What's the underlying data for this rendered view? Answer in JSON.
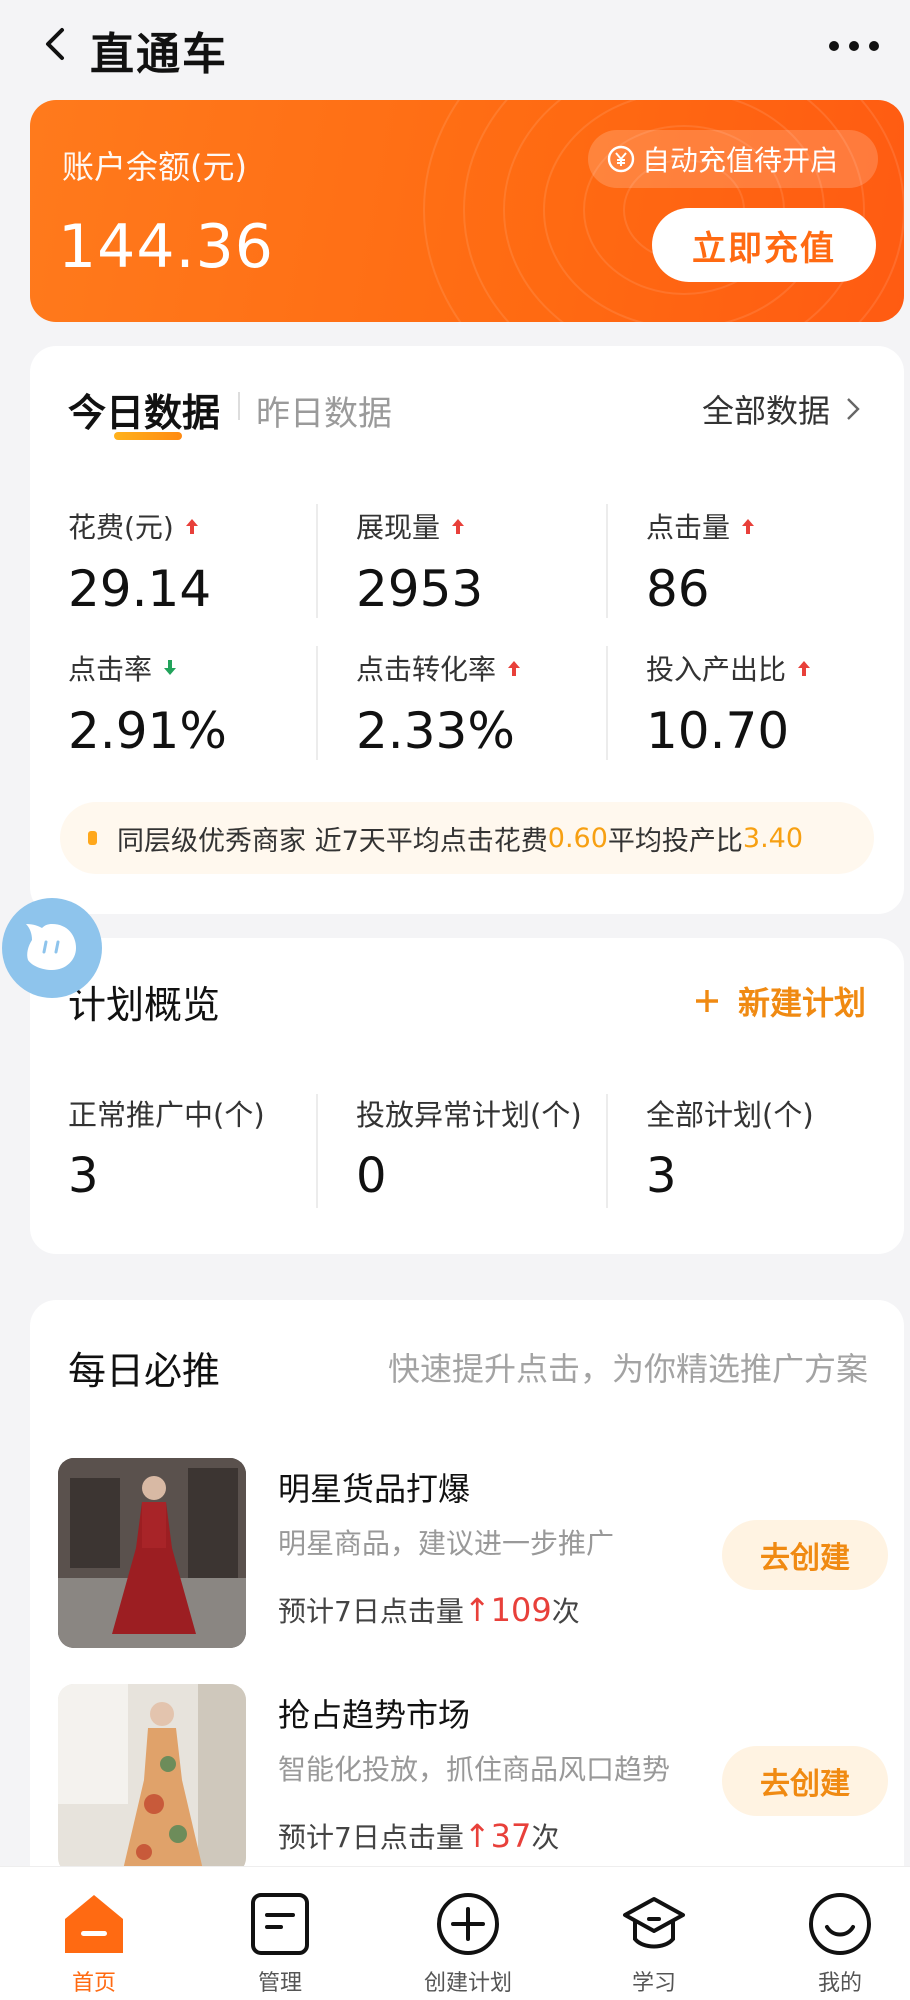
{
  "header": {
    "title": "直通车"
  },
  "balance": {
    "label": "账户余额(元)",
    "value": "144.36",
    "auto_recharge": "自动充值待开启",
    "recharge_button": "立即充值"
  },
  "today": {
    "tab_active": "今日数据",
    "tab_inactive": "昨日数据",
    "all_data": "全部数据",
    "metrics": [
      {
        "label": "花费(元)",
        "value": "29.14",
        "trend": "up"
      },
      {
        "label": "展现量",
        "value": "2953",
        "trend": "up"
      },
      {
        "label": "点击量",
        "value": "86",
        "trend": "up"
      },
      {
        "label": "点击率",
        "value": "2.91%",
        "trend": "down"
      },
      {
        "label": "点击转化率",
        "value": "2.33%",
        "trend": "up"
      },
      {
        "label": "投入产出比",
        "value": "10.70",
        "trend": "up"
      }
    ],
    "benchmark": {
      "prefix": "同层级优秀商家 近7天平均点击花费",
      "avg_click_cost": "0.60",
      "middle": "平均投产比",
      "avg_roi": "3.40"
    }
  },
  "plans": {
    "title": "计划概览",
    "new_plan": "新建计划",
    "stats": [
      {
        "label": "正常推广中(个)",
        "value": "3"
      },
      {
        "label": "投放异常计划(个)",
        "value": "0"
      },
      {
        "label": "全部计划(个)",
        "value": "3"
      }
    ]
  },
  "must_push": {
    "title": "每日必推",
    "subtitle": "快速提升点击，为你精选推广方案",
    "items": [
      {
        "name": "明星货品打爆",
        "desc": "明星商品，建议进一步推广",
        "est_prefix": "预计7日点击量",
        "est_value": "↑109",
        "est_suffix": "次",
        "button": "去创建"
      },
      {
        "name": "抢占趋势市场",
        "desc": "智能化投放，抓住商品风口趋势",
        "est_prefix": "预计7日点击量",
        "est_value": "↑37",
        "est_suffix": "次",
        "button": "去创建"
      }
    ]
  },
  "tabbar": [
    {
      "label": "首页",
      "icon": "home-icon",
      "active": true
    },
    {
      "label": "管理",
      "icon": "manage-icon",
      "active": false
    },
    {
      "label": "创建计划",
      "icon": "plus-circle-icon",
      "active": false
    },
    {
      "label": "学习",
      "icon": "graduation-cap-icon",
      "active": false
    },
    {
      "label": "我的",
      "icon": "smile-icon",
      "active": false
    }
  ],
  "colors": {
    "accent": "#ff6a12",
    "highlight": "#f7a012",
    "up": "#e8403a",
    "down": "#22a35b"
  }
}
